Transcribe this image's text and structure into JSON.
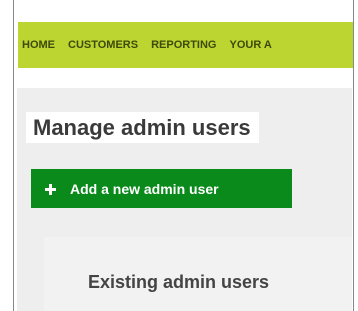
{
  "nav": {
    "items": [
      {
        "label": "HOME"
      },
      {
        "label": "CUSTOMERS"
      },
      {
        "label": "REPORTING"
      },
      {
        "label": "YOUR A"
      }
    ]
  },
  "page": {
    "title": "Manage admin users"
  },
  "actions": {
    "add_label": "Add a new admin user",
    "add_icon": "plus-icon"
  },
  "panel": {
    "title": "Existing admin users"
  },
  "colors": {
    "nav_background": "#bcd531",
    "nav_text": "#3d4a0c",
    "button_background": "#0a8a1b",
    "content_background": "#eeeeee"
  }
}
